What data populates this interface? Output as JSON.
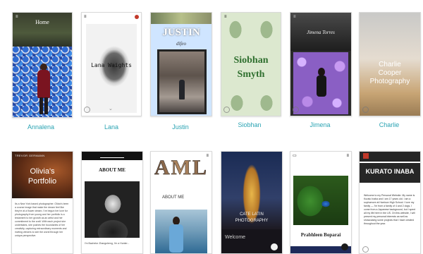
{
  "colors": {
    "label": "#2aa3b3",
    "background": "#ffffff"
  },
  "row1": [
    {
      "name": "Annalena",
      "heading": "Home"
    },
    {
      "name": "Lana",
      "heading": "Lana Waights"
    },
    {
      "name": "Justin",
      "heading": "JUSTIN",
      "sub": "difeo"
    },
    {
      "name": "Siobhan",
      "heading": "Siobhan",
      "heading2": "Smyth"
    },
    {
      "name": "Jimena",
      "heading": "Jimena Torres"
    },
    {
      "name": "Charlie",
      "heading": "Charlie",
      "heading2": "Cooper",
      "heading3": "Photography"
    }
  ],
  "row2": [
    {
      "header": "TREVOR GERMANN",
      "title": "Olivia's",
      "title2": "Portfolio",
      "body": "Its a New York based photographer. Olivia's been a course image that make the dream feel like they're at a flower dream. I've begun her love for photography from young and her portfolio is a testament to her growth as an artist and her commitment to the craft. With each project she undertakes, she pushes the boundaries of her creativity, capturing extraordinary moments and inviting viewers to see the world through her unique perspective."
    },
    {
      "header": "ABOUT ME",
      "caption": "I'm Bachelor Zhangsheng, I'm a Hunter..."
    },
    {
      "header": "AML",
      "sub": "ABOUT ME"
    },
    {
      "title": "CATE LATIN",
      "title2": "PHOTOGRAPHY",
      "footer": "Welcome"
    },
    {
      "name": "Prabhleen Boparai"
    },
    {
      "title": "KURATO INABA",
      "body": "Welcome to my Personal Website. My name is Kurato Inaba and I am 17 years old. I am a sophomore at Harrison High School. I love my family — I'm from a family of 4 and 2 dogs. I come from a Japanese background, but I spent all my life here in the US. On this website, I will present my personal interests as well as showcasing some projects that I have created throughout the year."
    }
  ]
}
